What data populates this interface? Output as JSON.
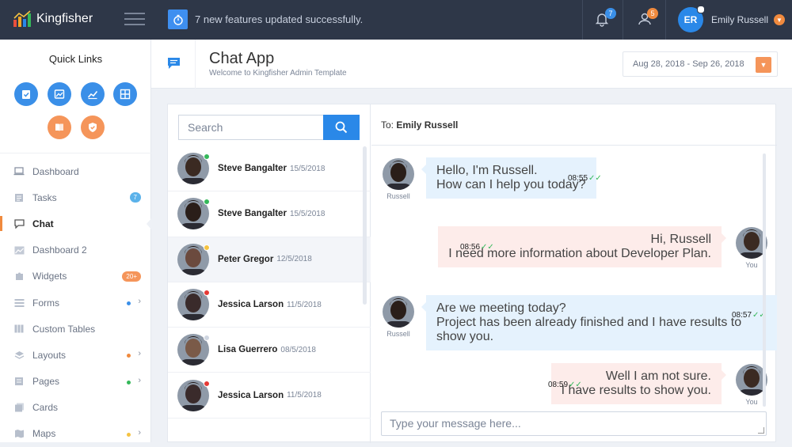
{
  "brand": {
    "name": "Kingfisher"
  },
  "topbar": {
    "notification_text": "7 new features updated successfully.",
    "bell_badge": "7",
    "users_badge": "5",
    "user_initials": "ER",
    "user_name": "Emily Russell"
  },
  "sidebar": {
    "quick_links_title": "Quick Links",
    "quick_links": [
      {
        "icon": "check-clipboard-icon",
        "color": "blue"
      },
      {
        "icon": "image-icon",
        "color": "blue"
      },
      {
        "icon": "chart-icon",
        "color": "blue"
      },
      {
        "icon": "grid-icon",
        "color": "blue"
      },
      {
        "icon": "book-icon",
        "color": "orange"
      },
      {
        "icon": "shield-check-icon",
        "color": "orange"
      }
    ],
    "items": [
      {
        "label": "Dashboard",
        "icon": "laptop-icon"
      },
      {
        "label": "Tasks",
        "icon": "tasks-icon",
        "badge": "7",
        "badge_color": "#5bb2ea"
      },
      {
        "label": "Chat",
        "icon": "chat-icon",
        "active": true
      },
      {
        "label": "Dashboard 2",
        "icon": "image-icon"
      },
      {
        "label": "Widgets",
        "icon": "puzzle-icon",
        "badge": "20+",
        "badge_color": "#f5955a"
      },
      {
        "label": "Forms",
        "icon": "forms-icon",
        "dot": "#3a8fe8",
        "chevron": true
      },
      {
        "label": "Custom Tables",
        "icon": "table-icon"
      },
      {
        "label": "Layouts",
        "icon": "layers-icon",
        "dot": "#f08a3e",
        "chevron": true
      },
      {
        "label": "Pages",
        "icon": "pages-icon",
        "dot": "#35b85a",
        "chevron": true
      },
      {
        "label": "Cards",
        "icon": "cards-icon"
      },
      {
        "label": "Maps",
        "icon": "map-icon",
        "dot": "#f5c342",
        "chevron": true
      }
    ]
  },
  "header": {
    "title": "Chat App",
    "subtitle": "Welcome to Kingfisher Admin Template",
    "date_range": "Aug 28, 2018 - Sep 26, 2018"
  },
  "chat": {
    "search_placeholder": "Search",
    "contacts": [
      {
        "name": "Steve Bangalter",
        "date": "15/5/2018",
        "status": "#35b85a",
        "skin": "#3b2a22"
      },
      {
        "name": "Steve Bangalter",
        "date": "15/5/2018",
        "status": "#35b85a",
        "skin": "#2a1e19"
      },
      {
        "name": "Peter Gregor",
        "date": "12/5/2018",
        "status": "#f5c342",
        "skin": "#6b4a3e",
        "selected": true
      },
      {
        "name": "Jessica Larson",
        "date": "11/5/2018",
        "status": "#e53935",
        "skin": "#3a2b2b"
      },
      {
        "name": "Lisa Guerrero",
        "date": "08/5/2018",
        "status": "#cfd6e1",
        "skin": "#7a5a48"
      },
      {
        "name": "Jessica Larson",
        "date": "11/5/2018",
        "status": "#e53935",
        "skin": "#3a2b2b"
      }
    ],
    "to_label": "To:",
    "to_name": "Emily Russell",
    "messages": [
      {
        "dir": "in",
        "sender": "Russell",
        "lines": [
          "Hello, I'm Russell.",
          "How can I help you today?"
        ],
        "time": "08:55"
      },
      {
        "dir": "out",
        "sender": "You",
        "lines": [
          "Hi, Russell",
          "I need more information about Developer Plan."
        ],
        "time": "08:56"
      },
      {
        "dir": "in",
        "sender": "Russell",
        "lines": [
          "Are we meeting today?",
          "Project has been already finished and I have results to show you."
        ],
        "time": "08:57"
      },
      {
        "dir": "out",
        "sender": "You",
        "lines": [
          "Well I am not sure.",
          "I have results to show you."
        ],
        "time": "08:59"
      }
    ],
    "composer_placeholder": "Type your message here..."
  }
}
